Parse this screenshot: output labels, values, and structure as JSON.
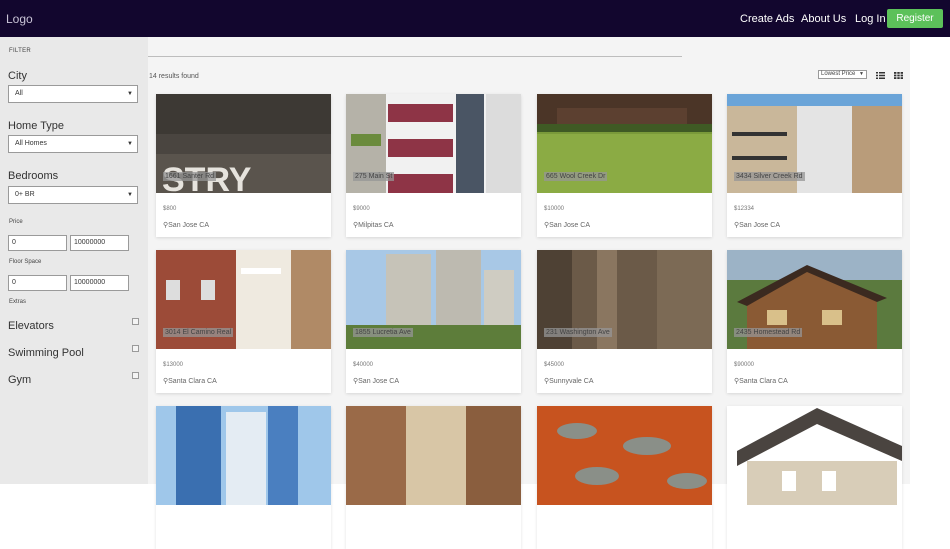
{
  "navbar": {
    "logo": "Logo",
    "links": [
      {
        "label": "Create Ads"
      },
      {
        "label": "About Us"
      },
      {
        "label": "Log In"
      }
    ],
    "register": "Register",
    "colors": {
      "bar": "#12062e",
      "register": "#5cc15a"
    }
  },
  "sidebar": {
    "heading": "FILTER",
    "city": {
      "label": "City",
      "value": "All"
    },
    "home_type": {
      "label": "Home Type",
      "value": "All Homes"
    },
    "bedrooms": {
      "label": "Bedrooms",
      "value": "0+ BR"
    },
    "price": {
      "label": "Price",
      "min": "0",
      "max": "10000000"
    },
    "floor_space": {
      "label": "Floor Space",
      "min": "0",
      "max": "10000000"
    },
    "extras": {
      "label": "Extras",
      "items": [
        {
          "label": "Elevators"
        },
        {
          "label": "Swimming Pool"
        },
        {
          "label": "Gym"
        }
      ]
    }
  },
  "main": {
    "results_text": "14 results found",
    "sort_value": "Lowest Price",
    "view_icons": [
      "list-view-icon",
      "grid-view-icon"
    ],
    "listings": [
      {
        "address": "1661 Santer Rd",
        "price": "$800",
        "location": "San Jose CA"
      },
      {
        "address": "275 Main St",
        "price": "$9000",
        "location": "Milpitas CA"
      },
      {
        "address": "665 Wool Creek Dr",
        "price": "$10000",
        "location": "San Jose CA"
      },
      {
        "address": "3434 Silver Creek Rd",
        "price": "$12334",
        "location": "San Jose CA"
      },
      {
        "address": "3014 El Camino Real",
        "price": "$13000",
        "location": "Santa Clara CA"
      },
      {
        "address": "1855 Lucretia Ave",
        "price": "$40000",
        "location": "San Jose CA"
      },
      {
        "address": "231 Washington Ave",
        "price": "$45000",
        "location": "Sunnyvale CA"
      },
      {
        "address": "2435 Homestead Rd",
        "price": "$90000",
        "location": "Santa Clara CA"
      },
      {
        "address": "",
        "price": "",
        "location": ""
      },
      {
        "address": "",
        "price": "",
        "location": ""
      },
      {
        "address": "",
        "price": "",
        "location": ""
      },
      {
        "address": "",
        "price": "",
        "location": ""
      }
    ]
  }
}
